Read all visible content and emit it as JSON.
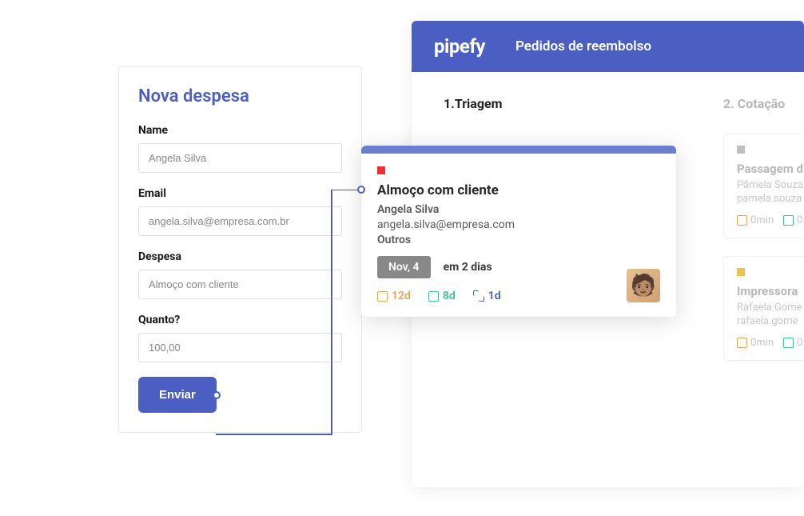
{
  "form": {
    "title": "Nova despesa",
    "fields": {
      "name": {
        "label": "Name",
        "value": "Angela Silva"
      },
      "email": {
        "label": "Email",
        "value": "angela.silva@empresa.com.br"
      },
      "despesa": {
        "label": "Despesa",
        "value": "Almoço com cliente"
      },
      "quanto": {
        "label": "Quanto?",
        "value": "100,00"
      }
    },
    "submit_label": "Enviar"
  },
  "board": {
    "brand": "pipefy",
    "title": "Pedidos de reembolso",
    "columns": [
      {
        "title": "1.Triagem"
      },
      {
        "title": "2. Cotação"
      }
    ],
    "cards": [
      {
        "status_color": "gray",
        "title": "Passagem d",
        "person": "Pâmela Souza",
        "email": "pamela.souza",
        "meta1": "0min",
        "meta2": "0"
      },
      {
        "status_color": "yellow",
        "title": "Impressora",
        "person": "Rafaela Gome",
        "email": "rafaela.gome",
        "meta1": "0min",
        "meta2": "0"
      }
    ]
  },
  "detail": {
    "title": "Almoço com cliente",
    "person": "Angela Silva",
    "email": "angela.silva@empresa.com",
    "category": "Outros",
    "date": "Nov, 4",
    "due": "em 2 dias",
    "meta": {
      "m1": "12d",
      "m2": "8d",
      "m3": "1d"
    }
  }
}
